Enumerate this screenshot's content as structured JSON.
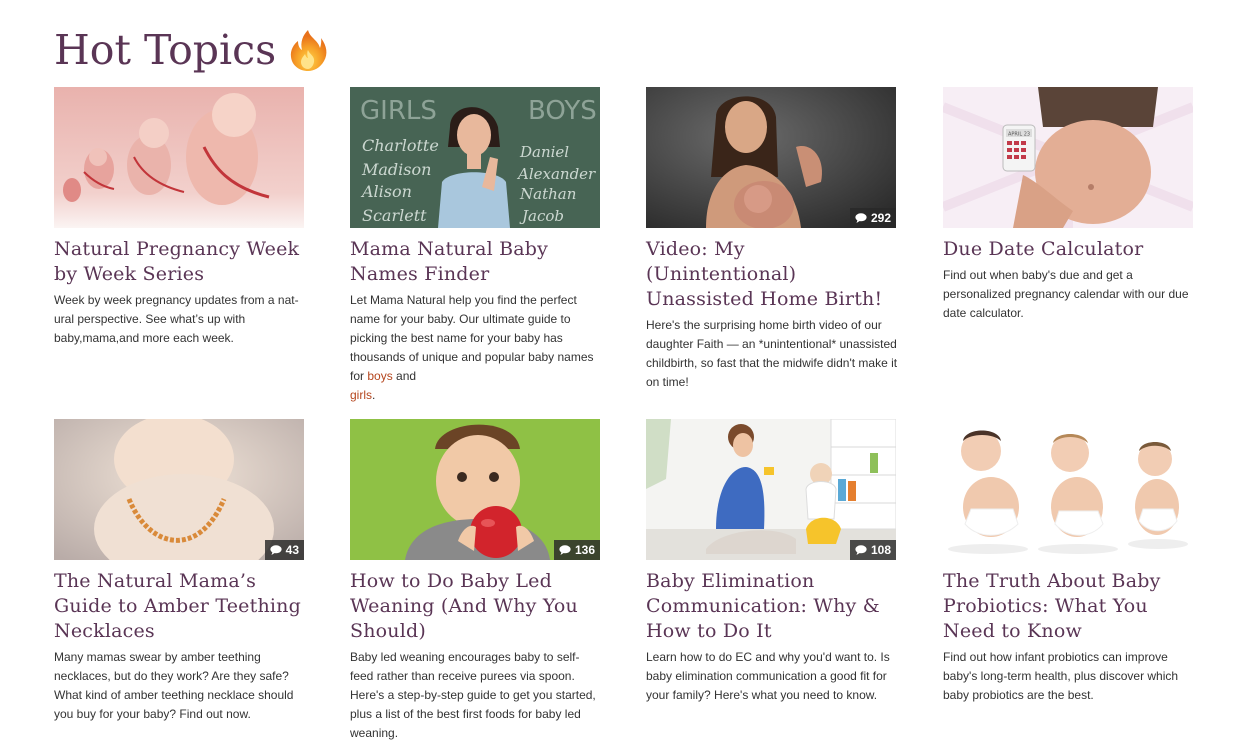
{
  "section": {
    "title": "Hot Topics",
    "title_icon": "fire-icon"
  },
  "cards": [
    {
      "title": "Natural Pregnancy Week by Week Series",
      "desc": "Week by week pregnancy updates from a nat-ural perspective. See what’s up with baby,mama,and more each week.",
      "image": "fetal-development-image",
      "comments": null
    },
    {
      "title": "Mama Natural Baby Names Finder",
      "desc_before": "Let Mama Natural help you find the perfect name for your baby. Our ultimate guide to picking the best name for your baby has thousands of unique and popular baby names for ",
      "link_boys": "boys",
      "desc_and": " and ",
      "link_girls": "girls",
      "desc_after": ".",
      "image": "chalkboard-names-image",
      "chalk": {
        "girls_header": "GIRLS",
        "boys_header": "BOYS",
        "girls": [
          "Charlotte",
          "Madison",
          "Alison",
          "Scarlett"
        ],
        "boys": [
          "Daniel",
          "Alexander",
          "Nathan",
          "Jacob"
        ]
      },
      "comments": null
    },
    {
      "title": "Video: My (Unintentional) Unassisted Home Birth!",
      "desc": "Here's the surprising home birth video of our daughter Faith — an *unintentional* unassisted childbirth, so fast that the midwife didn't make it on time!",
      "image": "mother-newborn-image",
      "comments": "292"
    },
    {
      "title": "Due Date Calculator",
      "desc": "Find out when baby's due and get a personalized pregnancy calendar with our due date calculator.",
      "image": "pregnant-belly-calendar-image",
      "calendar_label": "APRIL 23",
      "comments": null
    },
    {
      "title": "The Natural Mama’s Guide to Amber Teething Necklaces",
      "desc": "Many mamas swear by amber teething necklaces, but do they work? Are they safe? What kind of amber teething necklace should you buy for your baby? Find out now.",
      "image": "baby-amber-necklace-image",
      "comments": "43"
    },
    {
      "title": "How to Do Baby Led Weaning (And Why You Should)",
      "desc": "Baby led weaning encourages baby to self-feed rather than receive purees via spoon. Here's a step-by-step guide to get you started, plus a list of the best first foods for baby led weaning.",
      "image": "toddler-apple-image",
      "comments": "136"
    },
    {
      "title": "Baby Elimination Communication: Why & How to Do It",
      "desc": "Learn how to do EC and why you'd want to. Is baby elimination communication a good fit for your family? Here's what you need to know.",
      "image": "mother-baby-potty-image",
      "comments": "108"
    },
    {
      "title": "The Truth About Baby Probiotics: What You Need to Know",
      "desc": "Find out how infant probiotics can improve baby's long-term health, plus discover which baby probiotics are the best.",
      "image": "crawling-babies-image",
      "comments": null
    }
  ],
  "colors": {
    "heading": "#5a3555",
    "link": "#b5461e",
    "badge_bg": "#2b2b2b"
  }
}
